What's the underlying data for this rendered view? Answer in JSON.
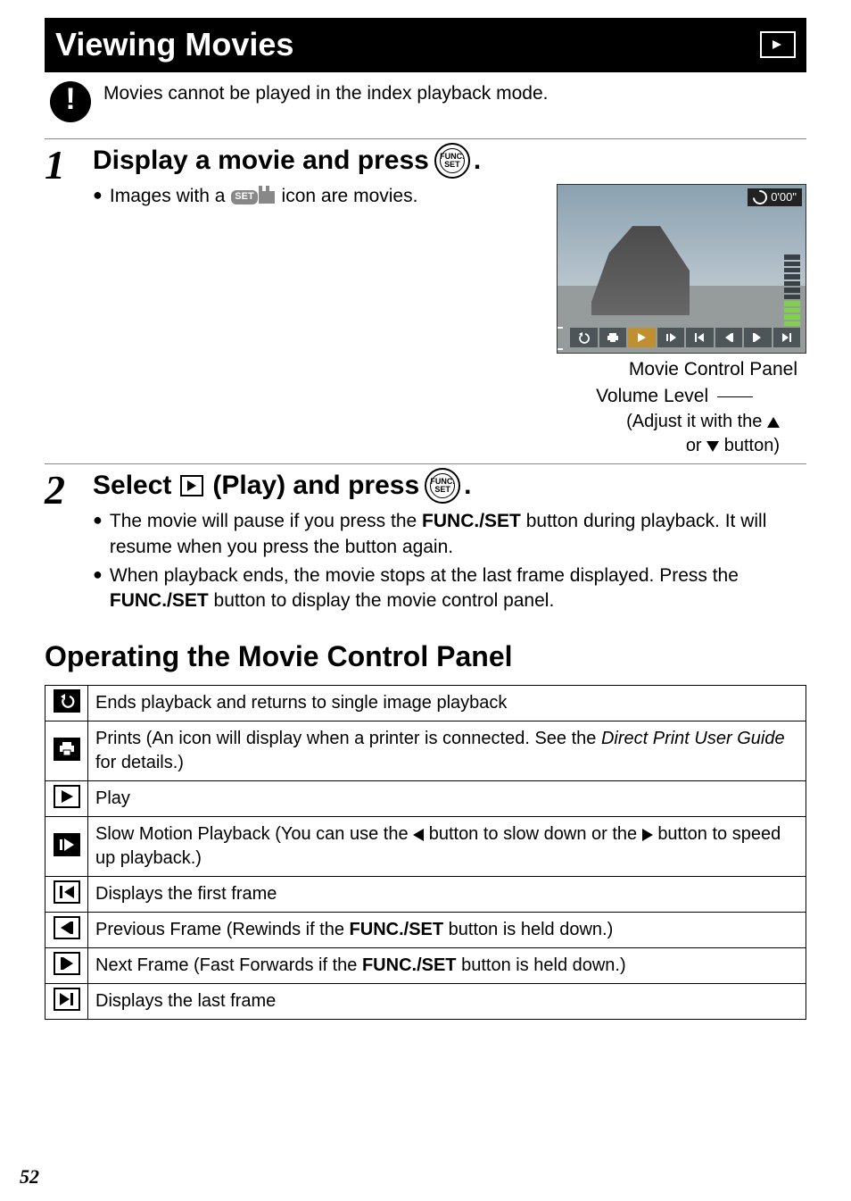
{
  "title": "Viewing Movies",
  "note": "Movies cannot be played in the index playback mode.",
  "step1": {
    "heading_pre": "Display a movie and press",
    "func_label": "FUNC.\nSET",
    "bullet_pre": "Images with a",
    "set_chip": "SET",
    "bullet_post": "icon are movies.",
    "preview_time": "0'00\"",
    "mc_label": "Movie Control Panel",
    "vl_label": "Volume Level",
    "adj_pre": "(Adjust it with the",
    "adj_mid": "or",
    "adj_post": "button)"
  },
  "step2": {
    "heading_pre": "Select",
    "heading_mid": "(Play) and press",
    "bullet1_a": "The movie will pause if you press the ",
    "bullet1_b": "FUNC./SET",
    "bullet1_c": " button during playback. It will resume when you press the button again.",
    "bullet2_a": "When playback ends, the movie stops at the last frame displayed. Press the ",
    "bullet2_b": "FUNC./SET",
    "bullet2_c": " button to display the movie control panel."
  },
  "section": "Operating the Movie Control Panel",
  "ops": [
    {
      "icon": "back",
      "text_parts": [
        "Ends playback and returns to single image playback"
      ]
    },
    {
      "icon": "print",
      "text_parts": [
        "Prints (An icon will display when a printer is connected. See the "
      ],
      "text_italic": "Direct Print User Guide",
      "text_tail": " for details.)"
    },
    {
      "icon": "play",
      "text_parts": [
        "Play"
      ]
    },
    {
      "icon": "slow",
      "text_pre": "Slow Motion Playback (You can use the ",
      "text_mid": " button to slow down or the ",
      "text_post": " button to speed up playback.)"
    },
    {
      "icon": "first",
      "text_parts": [
        "Displays the first frame"
      ]
    },
    {
      "icon": "prevf",
      "text_pre": "Previous Frame (Rewinds if the ",
      "text_bold": "FUNC./SET",
      "text_post": " button is held down.)"
    },
    {
      "icon": "nextf",
      "text_pre": "Next Frame (Fast Forwards if the ",
      "text_bold": "FUNC./SET",
      "text_post": " button is held down.)"
    },
    {
      "icon": "last",
      "text_parts": [
        "Displays the last frame"
      ]
    }
  ],
  "page_number": "52"
}
